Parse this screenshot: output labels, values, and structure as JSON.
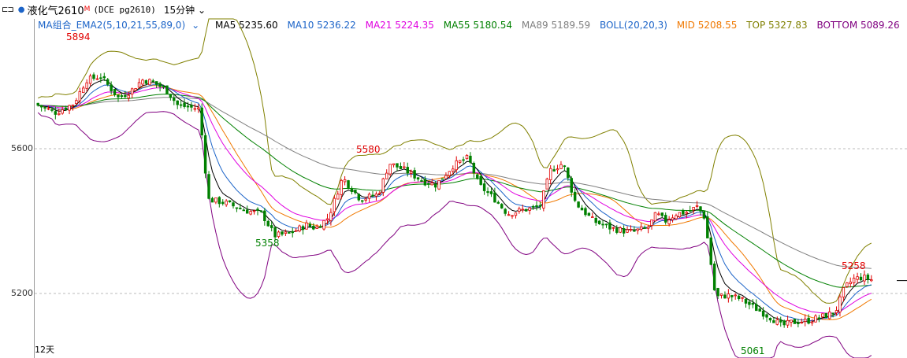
{
  "header": {
    "menu_glyph": "⊏⊐",
    "symbol": "液化气2610",
    "symbol_flag": "M",
    "exchange": "(DCE pg2610)",
    "period": "15分钟",
    "chevron": "chevron-down-icon"
  },
  "legend": {
    "combo": "MA组合_EMA2(5,10,21,55,89,0)",
    "ma5": "MA5 5235.60",
    "ma10": "MA10 5236.22",
    "ma21": "MA21 5224.35",
    "ma55": "MA55 5180.54",
    "ma89": "MA89 5189.59",
    "boll": "BOLL(20,20,3)",
    "mid": "MID 5208.55",
    "top": "TOP 5327.83",
    "bottom": "BOTTOM 5089.26"
  },
  "colors": {
    "ma5": "#000000",
    "ma10": "#1c64c8",
    "ma21": "#e000e0",
    "ma55": "#008000",
    "ma89": "#808080",
    "boll": "#1c64c8",
    "mid": "#f07800",
    "top": "#808000",
    "bottom": "#800080",
    "up": "#e00000",
    "down": "#008000"
  },
  "axis": {
    "y_ticks": [
      "5600",
      "5200"
    ],
    "day_label": "12天"
  },
  "annotations": {
    "high1": "5894",
    "high2": "5580",
    "low1": "5358",
    "high3": "5258",
    "low2": "5061"
  },
  "chart_data": {
    "type": "candlestick",
    "y_range": [
      5040,
      5960
    ],
    "y_ticks": [
      5200,
      5600
    ],
    "n_bars": 240,
    "close_anchors": [
      [
        0,
        5720
      ],
      [
        10,
        5700
      ],
      [
        20,
        5725
      ],
      [
        27,
        5790
      ],
      [
        35,
        5800
      ],
      [
        45,
        5740
      ],
      [
        52,
        5760
      ],
      [
        58,
        5790
      ],
      [
        64,
        5785
      ],
      [
        72,
        5760
      ],
      [
        78,
        5720
      ],
      [
        84,
        5715
      ],
      [
        90,
        5710
      ],
      [
        95,
        5460
      ],
      [
        105,
        5450
      ],
      [
        115,
        5430
      ],
      [
        125,
        5420
      ],
      [
        132,
        5360
      ],
      [
        140,
        5365
      ],
      [
        150,
        5390
      ],
      [
        155,
        5380
      ],
      [
        162,
        5410
      ],
      [
        170,
        5520
      ],
      [
        180,
        5460
      ],
      [
        190,
        5475
      ],
      [
        196,
        5560
      ],
      [
        205,
        5540
      ],
      [
        215,
        5510
      ],
      [
        222,
        5500
      ],
      [
        232,
        5555
      ],
      [
        240,
        5575
      ],
      [
        246,
        5500
      ],
      [
        255,
        5460
      ],
      [
        262,
        5420
      ],
      [
        270,
        5430
      ],
      [
        280,
        5440
      ],
      [
        286,
        5540
      ],
      [
        293,
        5560
      ],
      [
        300,
        5450
      ],
      [
        310,
        5400
      ],
      [
        320,
        5380
      ],
      [
        330,
        5370
      ],
      [
        340,
        5380
      ],
      [
        345,
        5420
      ],
      [
        350,
        5400
      ],
      [
        356,
        5420
      ],
      [
        362,
        5425
      ],
      [
        368,
        5440
      ],
      [
        372,
        5410
      ],
      [
        378,
        5190
      ],
      [
        385,
        5195
      ],
      [
        392,
        5185
      ],
      [
        400,
        5160
      ],
      [
        405,
        5145
      ],
      [
        410,
        5130
      ],
      [
        415,
        5110
      ],
      [
        420,
        5120
      ],
      [
        430,
        5125
      ],
      [
        440,
        5140
      ],
      [
        445,
        5150
      ],
      [
        450,
        5215
      ],
      [
        455,
        5240
      ],
      [
        460,
        5245
      ],
      [
        465,
        5238
      ]
    ],
    "annotation_points": [
      {
        "label": "5894",
        "value": 5894
      },
      {
        "label": "5580",
        "value": 5580
      },
      {
        "label": "5358",
        "value": 5358
      },
      {
        "label": "5258",
        "value": 5258
      },
      {
        "label": "5061",
        "value": 5061
      }
    ],
    "last_values": {
      "MA5": 5235.6,
      "MA10": 5236.22,
      "MA21": 5224.35,
      "MA55": 5180.54,
      "MA89": 5189.59,
      "MID": 5208.55,
      "TOP": 5327.83,
      "BOTTOM": 5089.26
    },
    "series": [
      {
        "name": "MA5"
      },
      {
        "name": "MA10"
      },
      {
        "name": "MA21"
      },
      {
        "name": "MA55"
      },
      {
        "name": "MA89"
      },
      {
        "name": "MID"
      },
      {
        "name": "TOP"
      },
      {
        "name": "BOTTOM"
      }
    ]
  }
}
